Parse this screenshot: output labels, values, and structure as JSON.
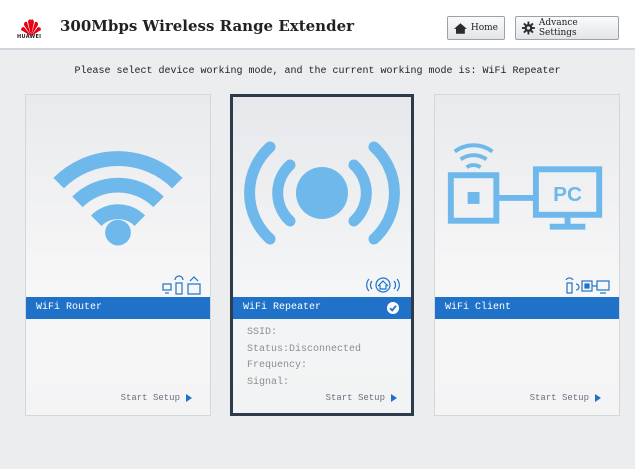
{
  "header": {
    "brand": "HUAWEI",
    "title": "300Mbps Wireless Range Extender",
    "home_label": "Home",
    "advance_label": "Advance Settings"
  },
  "prompt": "Please select device working mode, and the current working mode is: WiFi Repeater",
  "modes": [
    {
      "label": "WiFi Router",
      "icon": "wifi-router-icon",
      "setup_label": "Start Setup",
      "selected": false
    },
    {
      "label": "WiFi Repeater",
      "icon": "wifi-repeater-icon",
      "setup_label": "Start Setup",
      "selected": true,
      "details": [
        "SSID:",
        "Status:Disconnected",
        "Frequency:",
        "Signal:"
      ]
    },
    {
      "label": "WiFi Client",
      "icon": "wifi-client-icon",
      "setup_label": "Start Setup",
      "selected": false,
      "art_text": "PC"
    }
  ],
  "colors": {
    "accent": "#1f72c8",
    "art_blue": "#6fb8ec",
    "selected_border": "#2e3b4d",
    "brand_red": "#e60012"
  }
}
